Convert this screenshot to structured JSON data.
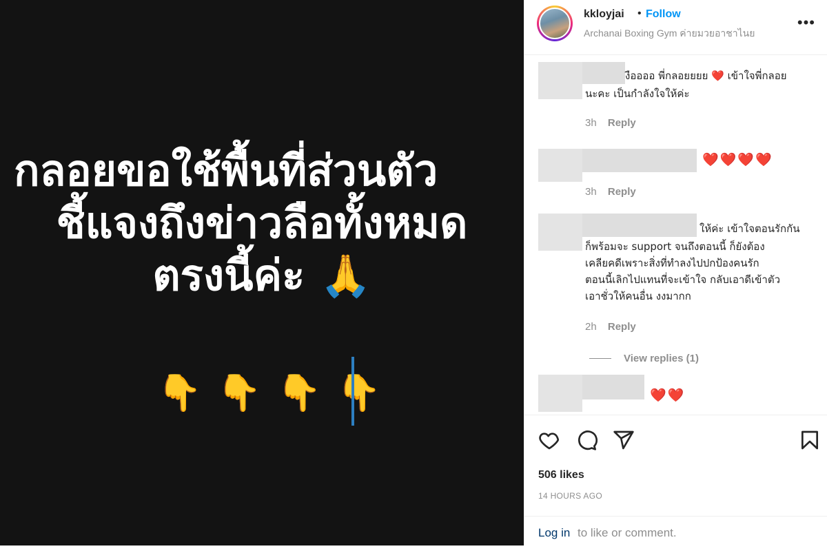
{
  "post": {
    "text_lines": [
      "กลอยขอใช้พื้นที่ส่วนตัว",
      "ชี้แจงถึงข่าวลือทั้งหมด",
      "ตรงนี้ค่ะ"
    ],
    "pray_emoji": "🙏",
    "finger_emoji": "👇"
  },
  "header": {
    "username": "kkloyjai",
    "separator": "•",
    "follow_label": "Follow",
    "location": "Archanai Boxing Gym ค่ายมวยอาชาไนย",
    "more_icon": "more-options-icon"
  },
  "comments": [
    {
      "lines": [
        "งืออออ พี่กลอยยยย ❤️ เข้าใจพี่กลอย",
        "นะคะ เป็นกำลังใจให้ค่ะ"
      ],
      "time": "3h",
      "reply_label": "Reply"
    },
    {
      "lines": [
        "❤️❤️❤️❤️"
      ],
      "time": "3h",
      "reply_label": "Reply"
    },
    {
      "lines": [
        "ให้ค่ะ เข้าใจตอนรักกัน",
        "ก็พร้อมจะ support จนถึงตอนนี้ ก็ยังต้อง",
        "เคลียคดีเพราะสิ่งที่ทำลงไปปกป้องคนรัก",
        "ตอนนี้เลิกไปแทนที่จะเข้าใจ กลับเอาดีเข้าตัว",
        "เอาชั่วให้คนอื่น งงมากก"
      ],
      "time": "2h",
      "reply_label": "Reply",
      "view_replies": "View replies (1)"
    },
    {
      "lines": [
        "❤️❤️"
      ]
    }
  ],
  "actions": {
    "likes": "506 likes",
    "time_ago": "14 HOURS AGO",
    "login_link": "Log in",
    "login_rest": "to like or comment.",
    "icons": [
      "heart-icon",
      "comment-icon",
      "share-icon",
      "bookmark-icon"
    ]
  },
  "colors": {
    "follow_blue": "#0095f6",
    "heart_red": "#e0245e",
    "post_bg": "#131313"
  }
}
